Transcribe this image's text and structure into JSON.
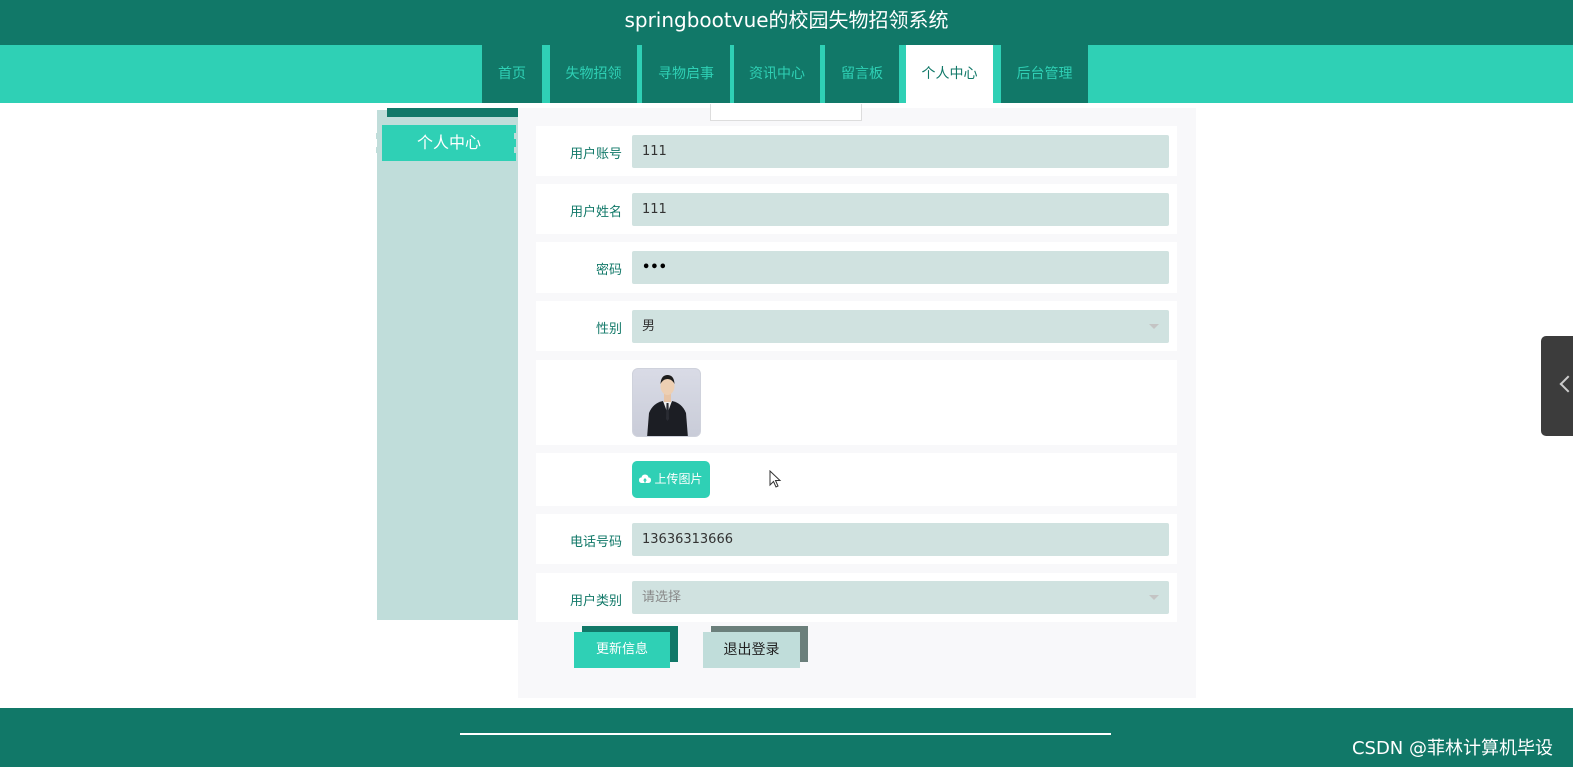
{
  "app": {
    "title": "springbootvue的校园失物招领系统"
  },
  "nav": {
    "items": [
      {
        "label": "首页"
      },
      {
        "label": "失物招领"
      },
      {
        "label": "寻物启事"
      },
      {
        "label": "资讯中心"
      },
      {
        "label": "留言板"
      },
      {
        "label": "个人中心"
      },
      {
        "label": "后台管理"
      }
    ],
    "active": "个人中心"
  },
  "sidebar": {
    "title": "个人中心"
  },
  "form": {
    "account": {
      "label": "用户账号",
      "value": "111"
    },
    "name": {
      "label": "用户姓名",
      "value": "111"
    },
    "password": {
      "label": "密码",
      "value": "•••"
    },
    "gender": {
      "label": "性别",
      "value": "男"
    },
    "avatar": {
      "icon": "avatar-photo"
    },
    "upload": {
      "label": "上传图片",
      "icon": "cloud-upload-icon"
    },
    "phone": {
      "label": "电话号码",
      "value": "13636313666"
    },
    "user_type": {
      "label": "用户类别",
      "placeholder": "请选择"
    }
  },
  "actions": {
    "update_label": "更新信息",
    "logout_label": "退出登录"
  },
  "footer": {
    "watermark": "CSDN @菲林计算机毕设"
  },
  "colors": {
    "primary_dark": "#117868",
    "primary_light": "#2fd0b5",
    "field_bg": "#d0e2e0",
    "sidebar_bg": "#c0ddda"
  }
}
